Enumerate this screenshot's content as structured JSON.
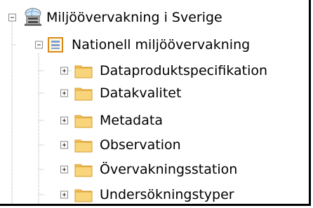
{
  "tree": {
    "root": {
      "label": "Miljöövervakning i Sverige",
      "icon": "database-server-icon",
      "expanded": true
    },
    "child": {
      "label": "Nationell miljöövervakning",
      "icon": "package-icon",
      "expanded": true
    },
    "folders": [
      {
        "label": "Dataproduktspecifikation",
        "icon": "folder-icon",
        "expanded": false
      },
      {
        "label": "Datakvalitet",
        "icon": "folder-icon",
        "expanded": false
      },
      {
        "label": "Metadata",
        "icon": "folder-icon",
        "expanded": false
      },
      {
        "label": "Observation",
        "icon": "folder-icon",
        "expanded": false
      },
      {
        "label": "Övervakningsstation",
        "icon": "folder-icon",
        "expanded": false
      },
      {
        "label": "Undersökningstyper",
        "icon": "folder-icon",
        "expanded": false
      }
    ]
  },
  "colors": {
    "folder": "#f5c55a",
    "folder_dark": "#d89b2a",
    "package_border": "#d98a1a",
    "package_fill": "#7f9fd6",
    "tree_lines": "#a0a0a0"
  }
}
